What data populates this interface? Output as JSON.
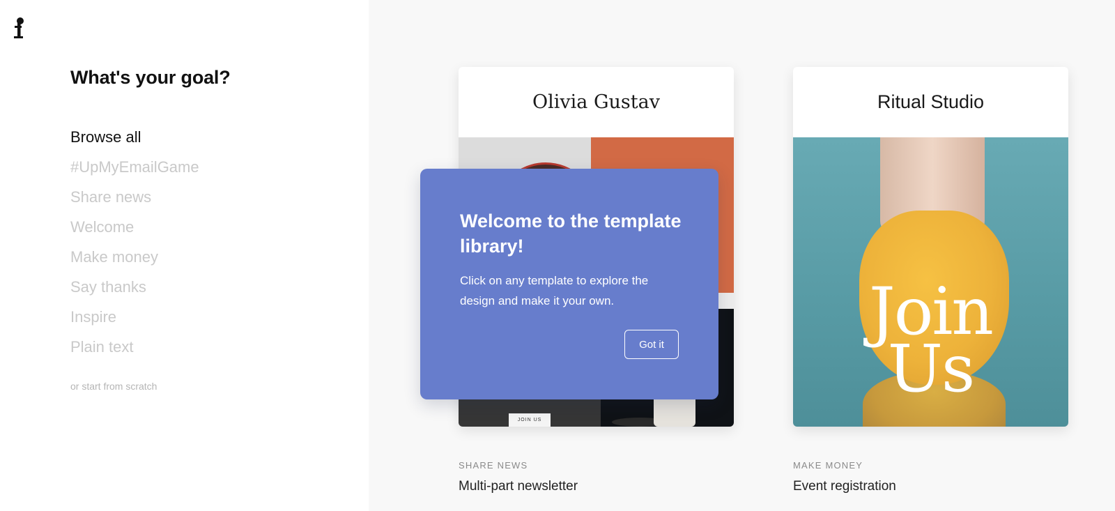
{
  "sidebar": {
    "logo_glyph": "f",
    "title": "What's your goal?",
    "goals": [
      {
        "label": "Browse all",
        "active": true
      },
      {
        "label": "#UpMyEmailGame",
        "active": false
      },
      {
        "label": "Share news",
        "active": false
      },
      {
        "label": "Welcome",
        "active": false
      },
      {
        "label": "Make money",
        "active": false
      },
      {
        "label": "Say thanks",
        "active": false
      },
      {
        "label": "Inspire",
        "active": false
      },
      {
        "label": "Plain text",
        "active": false
      }
    ],
    "scratch_link": "or start from scratch"
  },
  "templates": [
    {
      "header": "Olivia Gustav",
      "image_label": "JOIN US",
      "category": "SHARE NEWS",
      "title": "Multi-part newsletter"
    },
    {
      "header": "Ritual Studio",
      "image_text_line1": "Join",
      "image_text_line2": "Us",
      "category": "MAKE MONEY",
      "title": "Event registration"
    }
  ],
  "popover": {
    "title": "Welcome to the template library!",
    "body": "Click on any template to explore the design and make it your own.",
    "button_label": "Got it",
    "bg_color": "#677dcc"
  }
}
